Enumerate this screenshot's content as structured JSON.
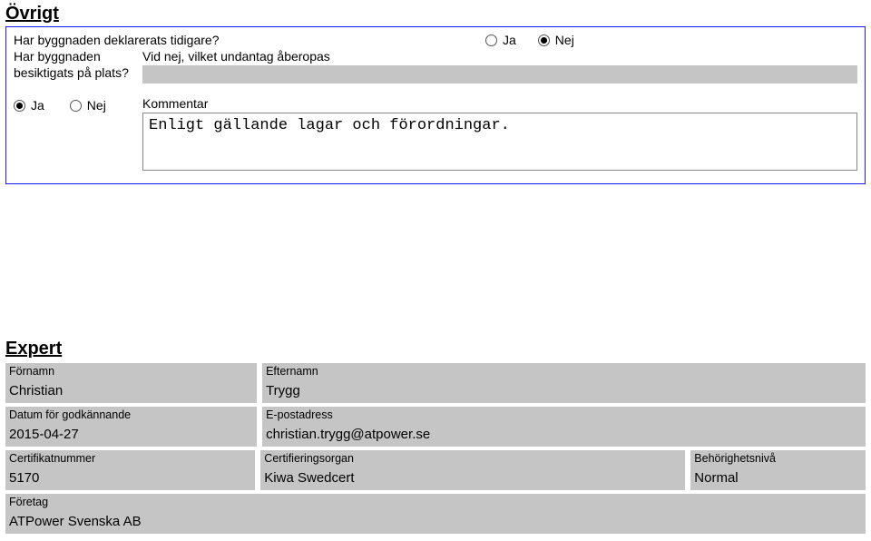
{
  "ovrigt": {
    "title": "Övrigt",
    "q_declared": "Har byggnaden deklarerats tidigare?",
    "q_inspected": "Har byggnaden besiktigats på plats?",
    "radio_yes": "Ja",
    "radio_no": "Nej",
    "declared_value": "no",
    "exemption_label": "Vid nej, vilket undantag åberopas",
    "exemption_value": "",
    "inspected_value": "yes",
    "comment_label": "Kommentar",
    "comment_value": "Enligt gällande lagar och förordningar."
  },
  "expert": {
    "title": "Expert",
    "labels": {
      "firstname": "Förnamn",
      "lastname": "Efternamn",
      "approval_date": "Datum för godkännande",
      "email": "E-postadress",
      "cert_no": "Certifikatnummer",
      "cert_body": "Certifieringsorgan",
      "auth_level": "Behörighetsnivå",
      "company": "Företag"
    },
    "values": {
      "firstname": "Christian",
      "lastname": "Trygg",
      "approval_date": "2015-04-27",
      "email": "christian.trygg@atpower.se",
      "cert_no": "5170",
      "cert_body": "Kiwa Swedcert",
      "auth_level": "Normal",
      "company": "ATPower Svenska AB"
    }
  }
}
